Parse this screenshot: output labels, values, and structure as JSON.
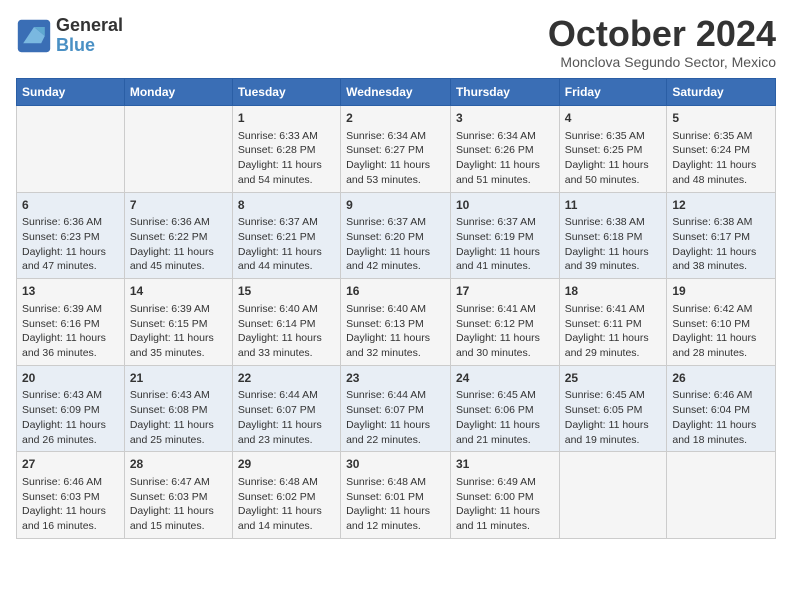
{
  "logo": {
    "general": "General",
    "blue": "Blue"
  },
  "title": "October 2024",
  "location": "Monclova Segundo Sector, Mexico",
  "days_of_week": [
    "Sunday",
    "Monday",
    "Tuesday",
    "Wednesday",
    "Thursday",
    "Friday",
    "Saturday"
  ],
  "weeks": [
    [
      {
        "day": "",
        "content": ""
      },
      {
        "day": "",
        "content": ""
      },
      {
        "day": "1",
        "content": "Sunrise: 6:33 AM\nSunset: 6:28 PM\nDaylight: 11 hours and 54 minutes."
      },
      {
        "day": "2",
        "content": "Sunrise: 6:34 AM\nSunset: 6:27 PM\nDaylight: 11 hours and 53 minutes."
      },
      {
        "day": "3",
        "content": "Sunrise: 6:34 AM\nSunset: 6:26 PM\nDaylight: 11 hours and 51 minutes."
      },
      {
        "day": "4",
        "content": "Sunrise: 6:35 AM\nSunset: 6:25 PM\nDaylight: 11 hours and 50 minutes."
      },
      {
        "day": "5",
        "content": "Sunrise: 6:35 AM\nSunset: 6:24 PM\nDaylight: 11 hours and 48 minutes."
      }
    ],
    [
      {
        "day": "6",
        "content": "Sunrise: 6:36 AM\nSunset: 6:23 PM\nDaylight: 11 hours and 47 minutes."
      },
      {
        "day": "7",
        "content": "Sunrise: 6:36 AM\nSunset: 6:22 PM\nDaylight: 11 hours and 45 minutes."
      },
      {
        "day": "8",
        "content": "Sunrise: 6:37 AM\nSunset: 6:21 PM\nDaylight: 11 hours and 44 minutes."
      },
      {
        "day": "9",
        "content": "Sunrise: 6:37 AM\nSunset: 6:20 PM\nDaylight: 11 hours and 42 minutes."
      },
      {
        "day": "10",
        "content": "Sunrise: 6:37 AM\nSunset: 6:19 PM\nDaylight: 11 hours and 41 minutes."
      },
      {
        "day": "11",
        "content": "Sunrise: 6:38 AM\nSunset: 6:18 PM\nDaylight: 11 hours and 39 minutes."
      },
      {
        "day": "12",
        "content": "Sunrise: 6:38 AM\nSunset: 6:17 PM\nDaylight: 11 hours and 38 minutes."
      }
    ],
    [
      {
        "day": "13",
        "content": "Sunrise: 6:39 AM\nSunset: 6:16 PM\nDaylight: 11 hours and 36 minutes."
      },
      {
        "day": "14",
        "content": "Sunrise: 6:39 AM\nSunset: 6:15 PM\nDaylight: 11 hours and 35 minutes."
      },
      {
        "day": "15",
        "content": "Sunrise: 6:40 AM\nSunset: 6:14 PM\nDaylight: 11 hours and 33 minutes."
      },
      {
        "day": "16",
        "content": "Sunrise: 6:40 AM\nSunset: 6:13 PM\nDaylight: 11 hours and 32 minutes."
      },
      {
        "day": "17",
        "content": "Sunrise: 6:41 AM\nSunset: 6:12 PM\nDaylight: 11 hours and 30 minutes."
      },
      {
        "day": "18",
        "content": "Sunrise: 6:41 AM\nSunset: 6:11 PM\nDaylight: 11 hours and 29 minutes."
      },
      {
        "day": "19",
        "content": "Sunrise: 6:42 AM\nSunset: 6:10 PM\nDaylight: 11 hours and 28 minutes."
      }
    ],
    [
      {
        "day": "20",
        "content": "Sunrise: 6:43 AM\nSunset: 6:09 PM\nDaylight: 11 hours and 26 minutes."
      },
      {
        "day": "21",
        "content": "Sunrise: 6:43 AM\nSunset: 6:08 PM\nDaylight: 11 hours and 25 minutes."
      },
      {
        "day": "22",
        "content": "Sunrise: 6:44 AM\nSunset: 6:07 PM\nDaylight: 11 hours and 23 minutes."
      },
      {
        "day": "23",
        "content": "Sunrise: 6:44 AM\nSunset: 6:07 PM\nDaylight: 11 hours and 22 minutes."
      },
      {
        "day": "24",
        "content": "Sunrise: 6:45 AM\nSunset: 6:06 PM\nDaylight: 11 hours and 21 minutes."
      },
      {
        "day": "25",
        "content": "Sunrise: 6:45 AM\nSunset: 6:05 PM\nDaylight: 11 hours and 19 minutes."
      },
      {
        "day": "26",
        "content": "Sunrise: 6:46 AM\nSunset: 6:04 PM\nDaylight: 11 hours and 18 minutes."
      }
    ],
    [
      {
        "day": "27",
        "content": "Sunrise: 6:46 AM\nSunset: 6:03 PM\nDaylight: 11 hours and 16 minutes."
      },
      {
        "day": "28",
        "content": "Sunrise: 6:47 AM\nSunset: 6:03 PM\nDaylight: 11 hours and 15 minutes."
      },
      {
        "day": "29",
        "content": "Sunrise: 6:48 AM\nSunset: 6:02 PM\nDaylight: 11 hours and 14 minutes."
      },
      {
        "day": "30",
        "content": "Sunrise: 6:48 AM\nSunset: 6:01 PM\nDaylight: 11 hours and 12 minutes."
      },
      {
        "day": "31",
        "content": "Sunrise: 6:49 AM\nSunset: 6:00 PM\nDaylight: 11 hours and 11 minutes."
      },
      {
        "day": "",
        "content": ""
      },
      {
        "day": "",
        "content": ""
      }
    ]
  ]
}
